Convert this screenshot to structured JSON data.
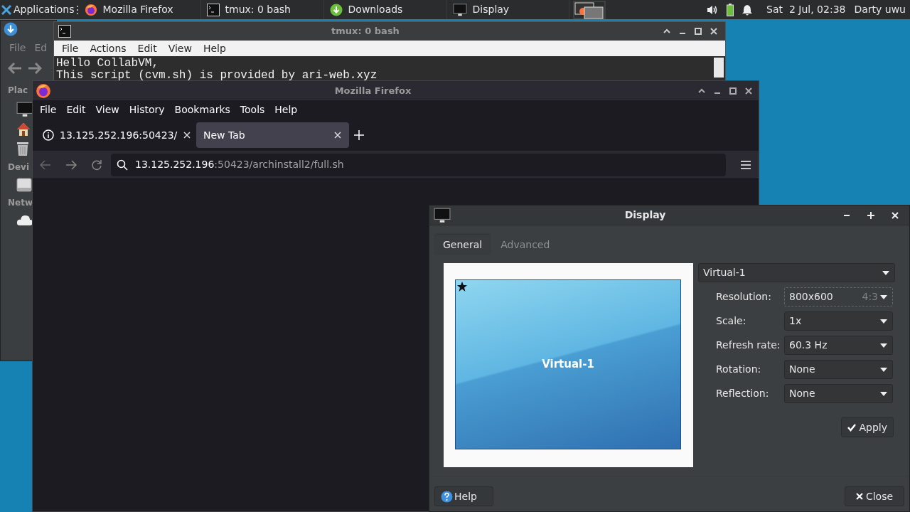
{
  "panel": {
    "applications": "Applications",
    "tasks": [
      {
        "label": "Mozilla Firefox"
      },
      {
        "label": "tmux: 0 bash"
      },
      {
        "label": "Downloads"
      },
      {
        "label": "Display"
      }
    ],
    "clock": "Sat  2 Jul, 02:38",
    "user": "Darty uwu"
  },
  "file_manager": {
    "menu": [
      "File",
      "Ed"
    ],
    "sections": [
      "Plac",
      "Devi",
      "Netw"
    ]
  },
  "terminal": {
    "title": "tmux: 0 bash",
    "menu": [
      "File",
      "Actions",
      "Edit",
      "View",
      "Help"
    ],
    "lines": [
      "Hello CollabVM,",
      "This script (cvm.sh) is provided by ari-web.xyz"
    ]
  },
  "firefox": {
    "title": "Mozilla Firefox",
    "menu": [
      "File",
      "Edit",
      "View",
      "History",
      "Bookmarks",
      "Tools",
      "Help"
    ],
    "tabs": [
      {
        "label": "13.125.252.196:50423/",
        "selected": false
      },
      {
        "label": "New Tab",
        "selected": true
      }
    ],
    "url": {
      "host": "13.125.252.196",
      "path": ":50423/archinstall2/full.sh"
    }
  },
  "display": {
    "title": "Display",
    "tabs": [
      {
        "label": "General",
        "selected": true
      },
      {
        "label": "Advanced",
        "selected": false
      }
    ],
    "preview_label": "Virtual-1",
    "monitor": "Virtual-1",
    "settings": [
      {
        "label": "Resolution:",
        "value": "800x600",
        "hint": "4:3"
      },
      {
        "label": "Scale:",
        "value": "1x"
      },
      {
        "label": "Refresh rate:",
        "value": "60.3 Hz"
      },
      {
        "label": "Rotation:",
        "value": "None"
      },
      {
        "label": "Reflection:",
        "value": "None"
      }
    ],
    "apply": "Apply",
    "help": "Help",
    "close": "Close"
  }
}
